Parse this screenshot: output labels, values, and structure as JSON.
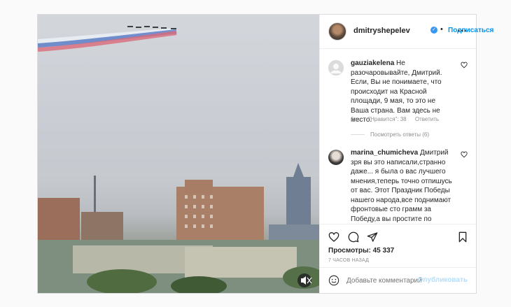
{
  "post": {
    "username": "dmitryshepelev",
    "follow_label": "Подписаться",
    "dot": "•",
    "more_icon": "more-horizontal-icon"
  },
  "comments": [
    {
      "username": "gauziakelena",
      "text": "Не разочаровывайте, Дмитрий. Если, Вы не понимаете, что происходит на Красной площади, 9 мая, то это не Ваша страна. Вам здесь не место.",
      "time": "6 ч.",
      "likes": "\"Нравится\": 38",
      "reply": "Ответить",
      "view_replies": "Посмотреть ответы (6)"
    },
    {
      "username": "marina_chumicheva",
      "text": "Дмитрий зря вы это написали,странно даже... я была о вас лучшего мнения,теперь точно отпишусь от вас. Этот Праздник Победы нашего народа,все поднимают фронтовые сто грамм за Победу,а вы простите по какому поводу грустите? Не рады что"
    }
  ],
  "actions": {
    "views_label": "Просмотры:",
    "views_count": "45 337",
    "time_ago": "7 ЧАСОВ НАЗАД"
  },
  "add_comment": {
    "placeholder": "Добавьте комментарий...",
    "publish_label": "Опубликовать"
  },
  "colors": {
    "accent": "#0095f6",
    "publish_disabled": "#b2dffc",
    "verified": "#3897f0"
  }
}
